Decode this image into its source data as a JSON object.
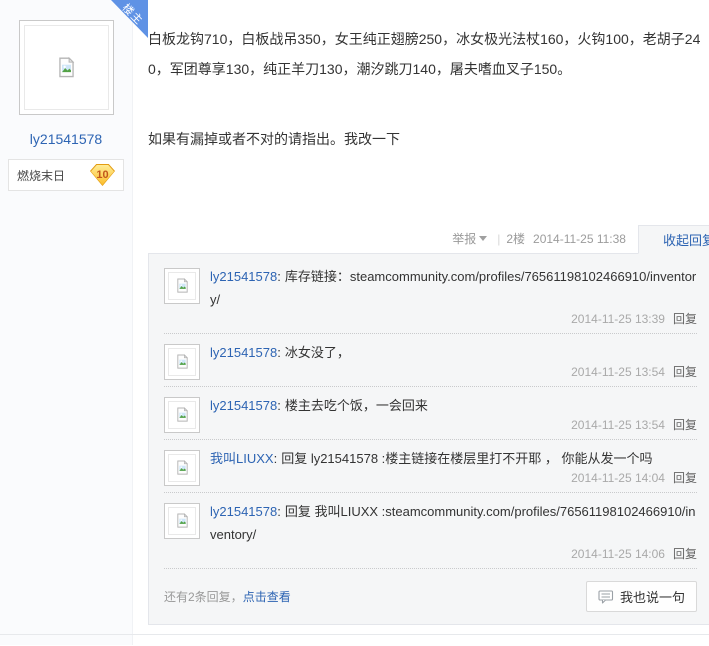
{
  "post": {
    "author": {
      "name": "ly21541578",
      "badge_name": "燃烧末日",
      "badge_level": "10",
      "ribbon": "楼主"
    },
    "content": {
      "line1": "白板龙钩710，白板战吊350，女王纯正翅膀250，冰女极光法杖160，火钩100，老胡子240，军团尊享130，纯正羊刀130，潮汐跳刀140，屠夫嗜血叉子150。",
      "line2": "如果有漏掉或者不对的请指出。我改一下"
    },
    "meta": {
      "report_label": "举报",
      "divider": "|",
      "floor": "2楼",
      "time": "2014-11-25 11:38",
      "collapse_label": "收起回复"
    }
  },
  "replies": {
    "colon": ":",
    "items": [
      {
        "user": "ly21541578",
        "text": "库存链接：steamcommunity.com/profiles/76561198102466910/inventory/",
        "time": "2014-11-25 13:39",
        "reply_label": "回复"
      },
      {
        "user": "ly21541578",
        "text": "冰女没了，",
        "time": "2014-11-25 13:54",
        "reply_label": "回复"
      },
      {
        "user": "ly21541578",
        "text": "楼主去吃个饭，一会回来",
        "time": "2014-11-25 13:54",
        "reply_label": "回复"
      },
      {
        "user": "我叫LIUXX",
        "text": "回复 ly21541578 :楼主链接在楼层里打不开耶 ， 你能从发一个吗",
        "time": "2014-11-25 14:04",
        "reply_label": "回复"
      },
      {
        "user": "ly21541578",
        "text": "回复 我叫LIUXX :steamcommunity.com/profiles/76561198102466910/inventory/",
        "time": "2014-11-25 14:06",
        "reply_label": "回复"
      }
    ],
    "more_prefix": "还有2条回复，",
    "view_link": "点击查看",
    "say_button": "我也说一句"
  },
  "colors": {
    "link_blue": "#2d64b3",
    "ribbon_blue": "#5f92e5",
    "panel_bg": "#f5f6f7",
    "panel_border": "#e4e6eb",
    "badge_gold": "#fbbd2b",
    "timestamp_gray": "#a9a9a9"
  }
}
